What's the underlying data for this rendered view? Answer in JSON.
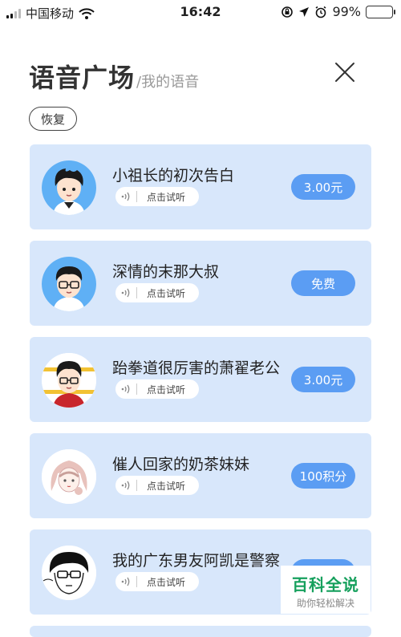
{
  "status_bar": {
    "carrier": "中国移动",
    "time": "16:42",
    "battery": "99%",
    "battery_level": 0.99,
    "icons": [
      "signal-icon",
      "wifi-icon",
      "screen-lock-icon",
      "location-icon",
      "alarm-icon",
      "battery-icon"
    ]
  },
  "header": {
    "title": "语音广场",
    "subtitle": "/我的语音",
    "restore_label": "恢复"
  },
  "items": [
    {
      "title": "小祖长的初次告白",
      "listen_label": "点击试听",
      "price": "3.00元",
      "avatar": "boy-cartoon-avatar"
    },
    {
      "title": "深情的末那大叔",
      "listen_label": "点击试听",
      "price": "免费",
      "avatar": "glasses-boy-avatar"
    },
    {
      "title": "跆拳道很厉害的萧翟老公",
      "listen_label": "点击试听",
      "price": "3.00元",
      "avatar": "red-shirt-boy-avatar"
    },
    {
      "title": "催人回家的奶茶妹妹",
      "listen_label": "点击试听",
      "price": "100积分",
      "avatar": "girl-sketch-avatar"
    },
    {
      "title": "我的广东男友阿凯是警察",
      "listen_label": "点击试听",
      "price": "",
      "avatar": "manga-boy-avatar"
    }
  ],
  "watermark": {
    "main": "百科全说",
    "sub": "助你轻松解决"
  },
  "colors": {
    "card_bg": "#d8e7fb",
    "price_button": "#5b9df3",
    "watermark_green": "#16a05d",
    "battery_green": "#4cd964"
  }
}
